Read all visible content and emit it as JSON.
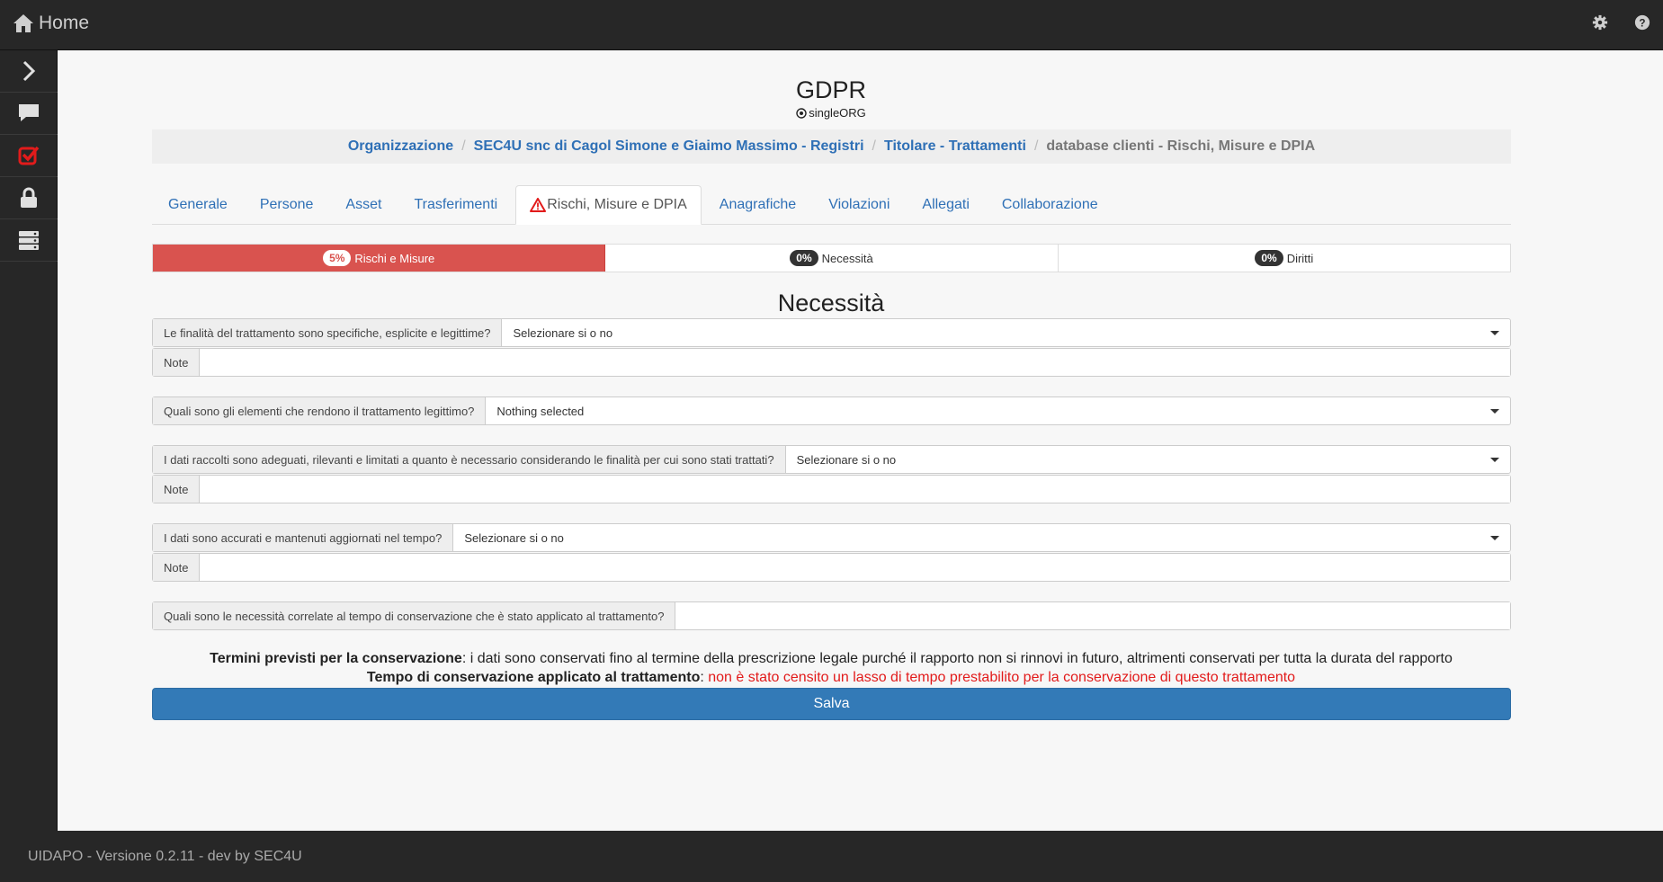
{
  "topbar": {
    "home_label": "Home",
    "icons": [
      "home-icon",
      "gear-icon",
      "help-icon"
    ]
  },
  "sidebar": {
    "items": [
      "chevron-right-icon",
      "chat-icon",
      "checkbox-icon",
      "lock-icon",
      "server-icon"
    ],
    "active_color": "#e21b1b"
  },
  "header": {
    "title": "GDPR",
    "subtitle": "singleORG"
  },
  "breadcrumb": {
    "items": [
      "Organizzazione",
      "SEC4U snc di Cagol Simone e Giaimo Massimo - Registri",
      "Titolare - Trattamenti"
    ],
    "active": "database clienti - Rischi, Misure e DPIA"
  },
  "tabs": [
    "Generale",
    "Persone",
    "Asset",
    "Trasferimenti",
    "Rischi, Misure e DPIA",
    "Anagrafiche",
    "Violazioni",
    "Allegati",
    "Collaborazione"
  ],
  "progress": [
    {
      "percent": "5%",
      "label": "Rischi e Misure"
    },
    {
      "percent": "0%",
      "label": "Necessità"
    },
    {
      "percent": "0%",
      "label": "Diritti"
    }
  ],
  "section_title": "Necessità",
  "form": {
    "q1": {
      "label": "Le finalità del trattamento sono specifiche, esplicite e legittime?",
      "value": "Selezionare si o no"
    },
    "note_label": "Note",
    "q2": {
      "label": "Quali sono gli elementi che rendono il trattamento legittimo?",
      "value": "Nothing selected"
    },
    "q3": {
      "label": "I dati raccolti sono adeguati, rilevanti e limitati a quanto è necessario considerando le finalità per cui sono stati trattati?",
      "value": "Selezionare si o no"
    },
    "q4": {
      "label": "I dati sono accurati e mantenuti aggiornati nel tempo?",
      "value": "Selezionare si o no"
    },
    "q5": {
      "label": "Quali sono le necessità correlate al tempo di conservazione che è stato applicato al trattamento?",
      "value": ""
    }
  },
  "info": {
    "line1_bold": "Termini previsti per la conservazione",
    "line1_text": ": i dati sono conservati fino al termine della prescrizione legale purché il rapporto non si rinnovi in futuro, altrimenti conservati per tutta la durata del rapporto",
    "line2_bold": "Tempo di conservazione applicato al trattamento",
    "line2_sep": ": ",
    "line2_red": "non è stato censito un lasso di tempo prestabilito per la conservazione di questo trattamento"
  },
  "save_label": "Salva",
  "footer": "UIDAPO - Versione 0.2.11 - dev by SEC4U"
}
